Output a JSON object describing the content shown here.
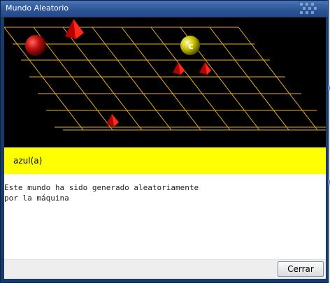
{
  "window": {
    "title": "Mundo Aleatorio"
  },
  "scene": {
    "objects": [
      {
        "shape": "sphere",
        "color": "red",
        "label": ""
      },
      {
        "shape": "pyramid",
        "color": "red",
        "label": ""
      },
      {
        "shape": "sphere",
        "color": "yellow",
        "label": "c"
      },
      {
        "shape": "pyramid",
        "color": "red",
        "label": ""
      },
      {
        "shape": "pyramid",
        "color": "red",
        "label": ""
      },
      {
        "shape": "pyramid",
        "color": "red",
        "label": ""
      }
    ]
  },
  "formula": {
    "text": "azul(a)"
  },
  "message": {
    "text": "Este mundo ha sido generado aleatoriamente\npor la máquina"
  },
  "footer": {
    "close_label": "Cerrar"
  },
  "colors": {
    "grid": "#e8b020",
    "formula_bg": "#ffff00",
    "titlebar": "#2d5596"
  }
}
